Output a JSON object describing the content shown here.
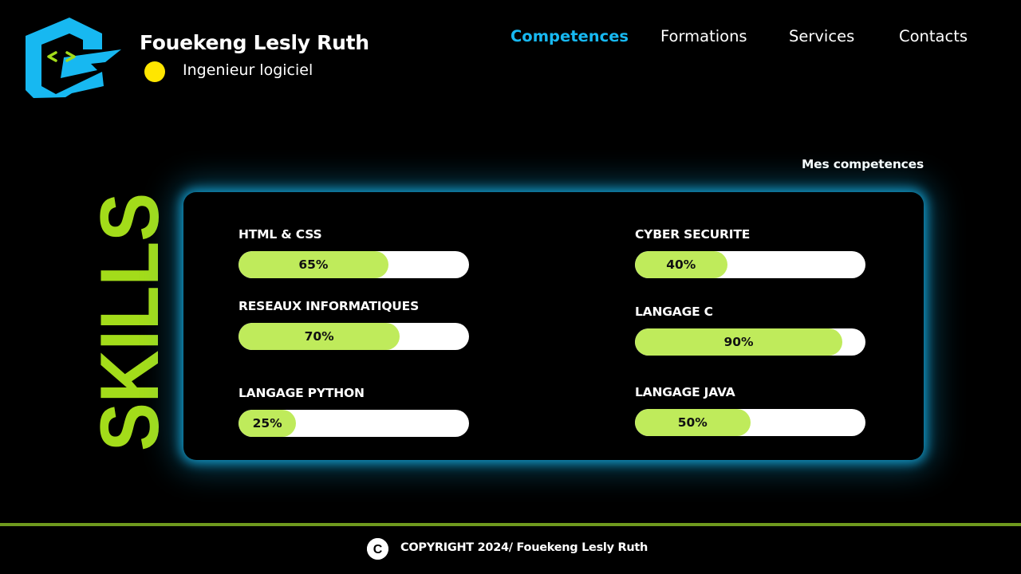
{
  "header": {
    "name": "Fouekeng Lesly Ruth",
    "role": "Ingenieur logiciel",
    "logo_icon": "code-brackets-logo-icon",
    "status_color": "#ffe600"
  },
  "nav": {
    "items": [
      {
        "label": "Competences",
        "active": true
      },
      {
        "label": "Formations",
        "active": false
      },
      {
        "label": "Services",
        "active": false
      },
      {
        "label": "Contacts",
        "active": false
      }
    ]
  },
  "skills_section": {
    "vertical_title": "SKILLS",
    "title": "Mes competences",
    "skills": [
      {
        "label": "HTML & CSS",
        "percent": 65,
        "percent_text": "65%"
      },
      {
        "label": "CYBER SECURITE",
        "percent": 40,
        "percent_text": "40%"
      },
      {
        "label": "RESEAUX INFORMATIQUES",
        "percent": 70,
        "percent_text": "70%"
      },
      {
        "label": "LANGAGE C",
        "percent": 90,
        "percent_text": "90%"
      },
      {
        "label": "LANGAGE PYTHON",
        "percent": 25,
        "percent_text": "25%"
      },
      {
        "label": "LANGAGE JAVA",
        "percent": 50,
        "percent_text": "50%"
      }
    ]
  },
  "footer": {
    "copyright_symbol": "C",
    "copyright_text": "COPYRIGHT 2024/ Fouekeng Lesly Ruth"
  },
  "colors": {
    "accent_blue": "#17b8f1",
    "accent_green": "#a3dc1a",
    "bar_fill": "#bfeb5b",
    "footer_rule": "#6f9a1e",
    "background": "#000000"
  }
}
